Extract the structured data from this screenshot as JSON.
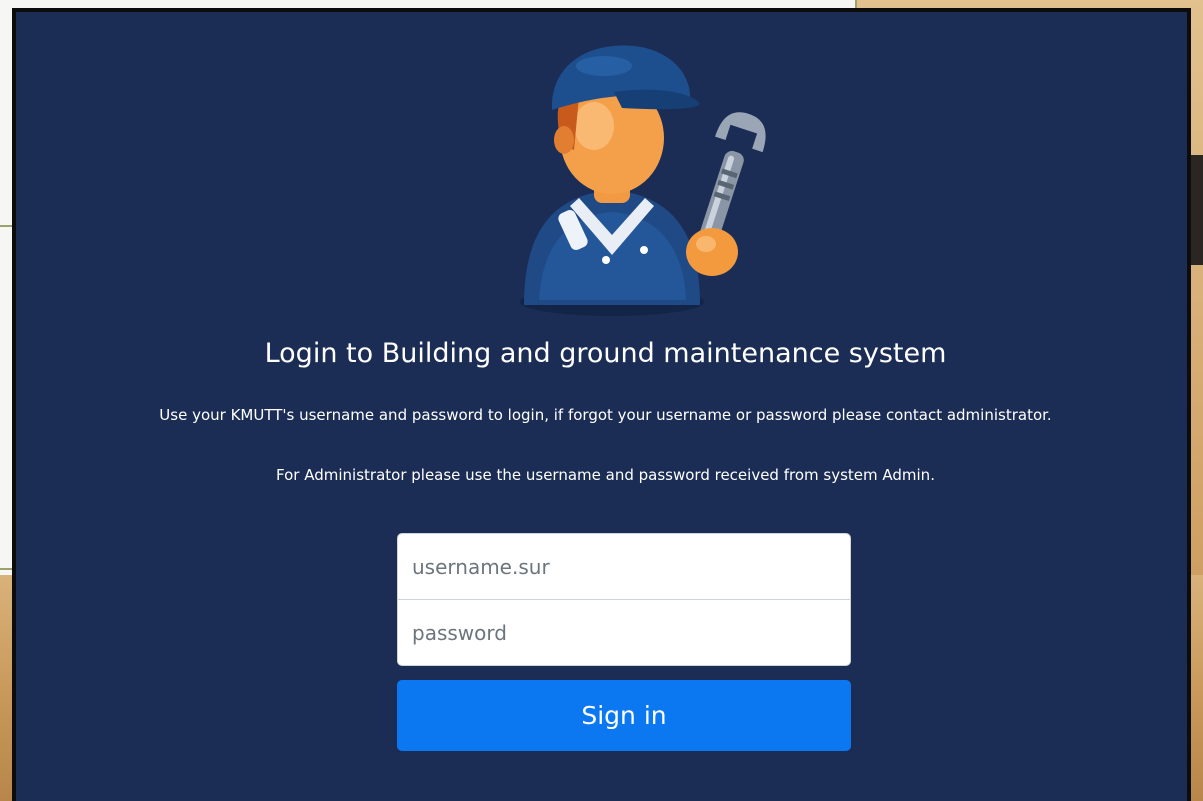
{
  "login": {
    "title": "Login to Building and ground maintenance system",
    "description": "Use your KMUTT's username and password to login, if forgot your username or password please contact administrator.",
    "admin_note": "For Administrator please use the username and password received from system Admin.",
    "username_placeholder": "username.sur",
    "username_value": "",
    "password_placeholder": "password",
    "password_value": "",
    "signin_label": "Sign in"
  },
  "colors": {
    "panel_background": "#1b2d55",
    "button_primary": "#0b78f2",
    "text_on_dark": "#ffffff"
  },
  "icons": {
    "mascot": "maintenance-worker-with-wrench-icon"
  }
}
